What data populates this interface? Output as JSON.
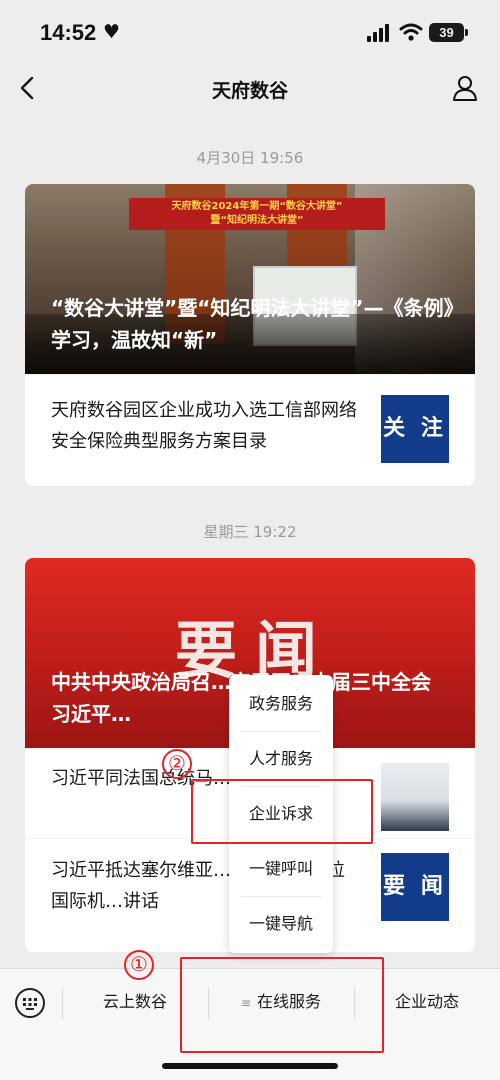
{
  "status_bar": {
    "time": "14:52",
    "battery": "39"
  },
  "nav": {
    "title": "天府数谷"
  },
  "feed": [
    {
      "timestamp": "4月30日 19:56",
      "hero_banner": "天府数谷2024年第一期“数谷大讲堂”\n暨“知纪明法大讲堂”",
      "hero_title": "“数谷大讲堂”暨“知纪明法大讲堂”—《条例》学习，温故知“新”",
      "rows": [
        {
          "text": "天府数谷园区企业成功入选工信部网络安全保险典型服务方案目录",
          "thumb_label": "关 注"
        }
      ]
    },
    {
      "timestamp": "星期三 19:22",
      "hero_big": "要闻",
      "hero_title": "中共中央政治局召…定召开二十届三中全会 习近平…",
      "rows": [
        {
          "text": "习近平同法国总统马…见记者"
        },
        {
          "text": "习近平抵达塞尔维亚…尼古拉·特斯拉国际机…讲话",
          "thumb_label": "要 闻"
        }
      ]
    }
  ],
  "popup_menu": {
    "items": [
      "政务服务",
      "人才服务",
      "企业诉求",
      "一键呼叫",
      "一键导航"
    ]
  },
  "tab_bar": {
    "tabs": [
      "云上数谷",
      "在线服务",
      "企业动态"
    ]
  },
  "annotations": [
    "①",
    "②"
  ],
  "colors": {
    "annotation": "#e3242b",
    "news_red": "#c41f1b",
    "thumb_blue": "#123c8a"
  }
}
